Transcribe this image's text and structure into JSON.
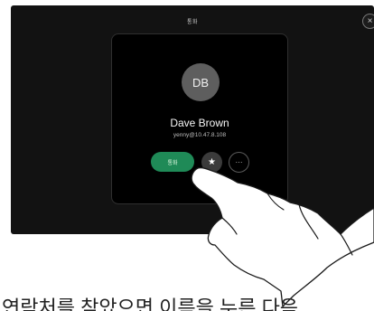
{
  "screen": {
    "title": "통화",
    "close_icon": "×"
  },
  "contact": {
    "initials": "DB",
    "name": "Dave Brown",
    "address": "yenny@10.47.8.108"
  },
  "actions": {
    "call_label": "통화",
    "favorite_icon": "★",
    "more_icon": "···"
  },
  "caption": {
    "text": "연락처를 찾았으면 이름을 누른 다음"
  }
}
